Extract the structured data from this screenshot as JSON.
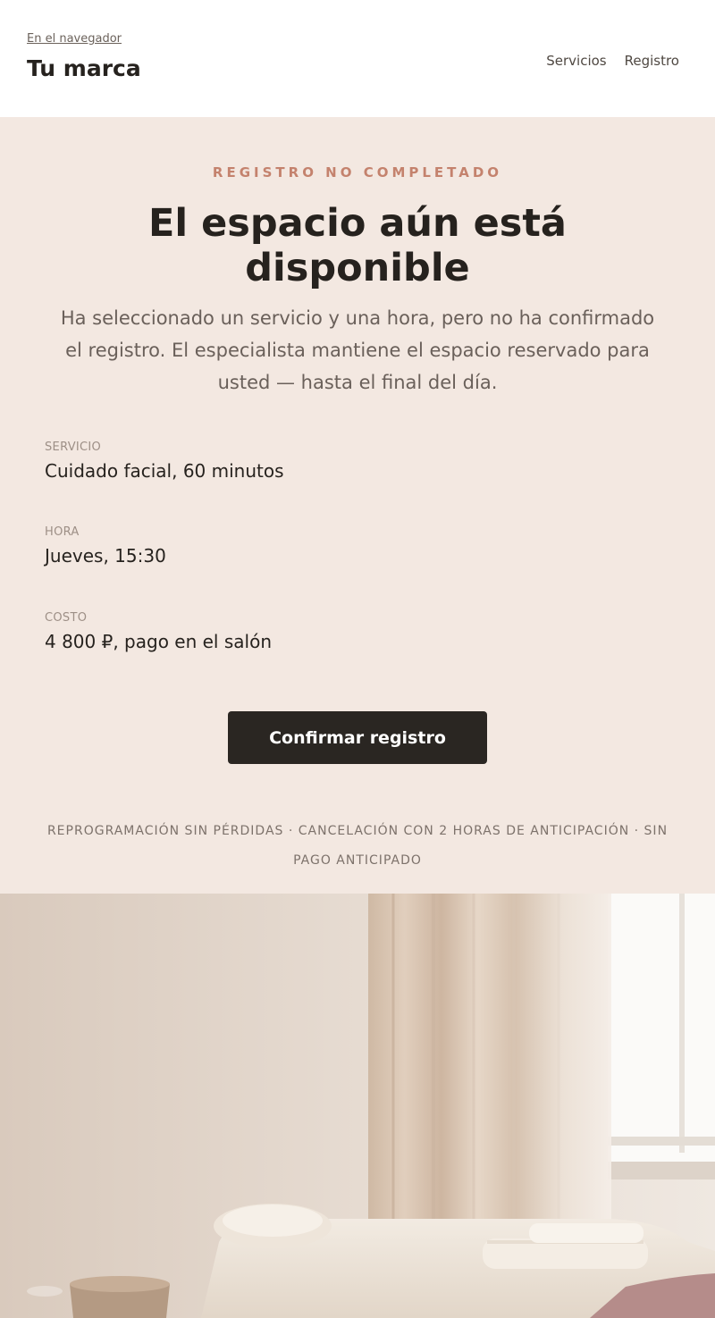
{
  "header": {
    "browser_link": "En el navegador",
    "brand": "Tu marca",
    "nav": [
      {
        "label": "Servicios"
      },
      {
        "label": "Registro"
      }
    ]
  },
  "hero": {
    "eyebrow": "REGISTRO NO COMPLETADO",
    "title": "El espacio aún está disponible",
    "lead": "Ha seleccionado un servicio y una hora, pero no ha confirmado el registro. El especialista mantiene el espacio reservado para usted — hasta el final del día."
  },
  "details": [
    {
      "label": "SERVICIO",
      "value": "Cuidado facial, 60 minutos"
    },
    {
      "label": "HORA",
      "value": "Jueves, 15:30"
    },
    {
      "label": "COSTO",
      "value": "4 800 ₽, pago en el salón"
    }
  ],
  "cta": {
    "label": "Confirmar registro"
  },
  "terms": "REPROGRAMACIÓN SIN PÉRDIDAS · CANCELACIÓN CON 2 HORAS DE ANTICIPACIÓN · SIN PAGO ANTICIPADO",
  "colors": {
    "accent": "#c4826d",
    "hero_bg": "#f3e8e1",
    "button_bg": "#2a2622",
    "text": "#26221e"
  }
}
